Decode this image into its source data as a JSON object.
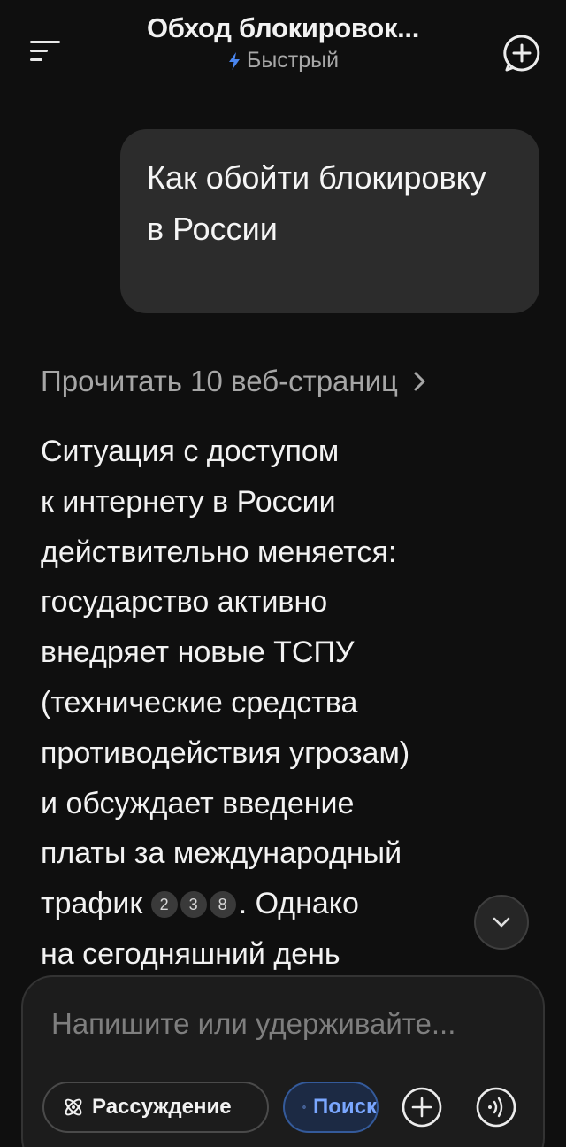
{
  "header": {
    "title": "Обход блокировок...",
    "mode_label": "Быстрый",
    "menu_icon": "menu-icon",
    "new_chat_icon": "new-chat-icon"
  },
  "user_message": {
    "text": "Как обойти блокировку в России"
  },
  "sources": {
    "label": "Прочитать 10 веб-страниц"
  },
  "answer": {
    "lines": [
      "Ситуация с доступом",
      "к интернету в России",
      "действительно меняется:",
      "государство активно",
      "внедряет новые ТСПУ",
      "(технические средства",
      "противодействия угрозам)",
      "и обсуждает введение",
      "платы за международный"
    ],
    "line10_prefix": "трафик",
    "citations": [
      "2",
      "3",
      "8"
    ],
    "line10_suffix": ". Однако",
    "line11": "на сегодняшний день"
  },
  "composer": {
    "placeholder": "Напишите или удерживайте...",
    "chip_reasoning": "Рассуждение",
    "chip_search": "Поиск"
  },
  "colors": {
    "background": "#0f0f0f",
    "bubble": "#2c2c2c",
    "accent_blue": "#7aa7ff"
  }
}
